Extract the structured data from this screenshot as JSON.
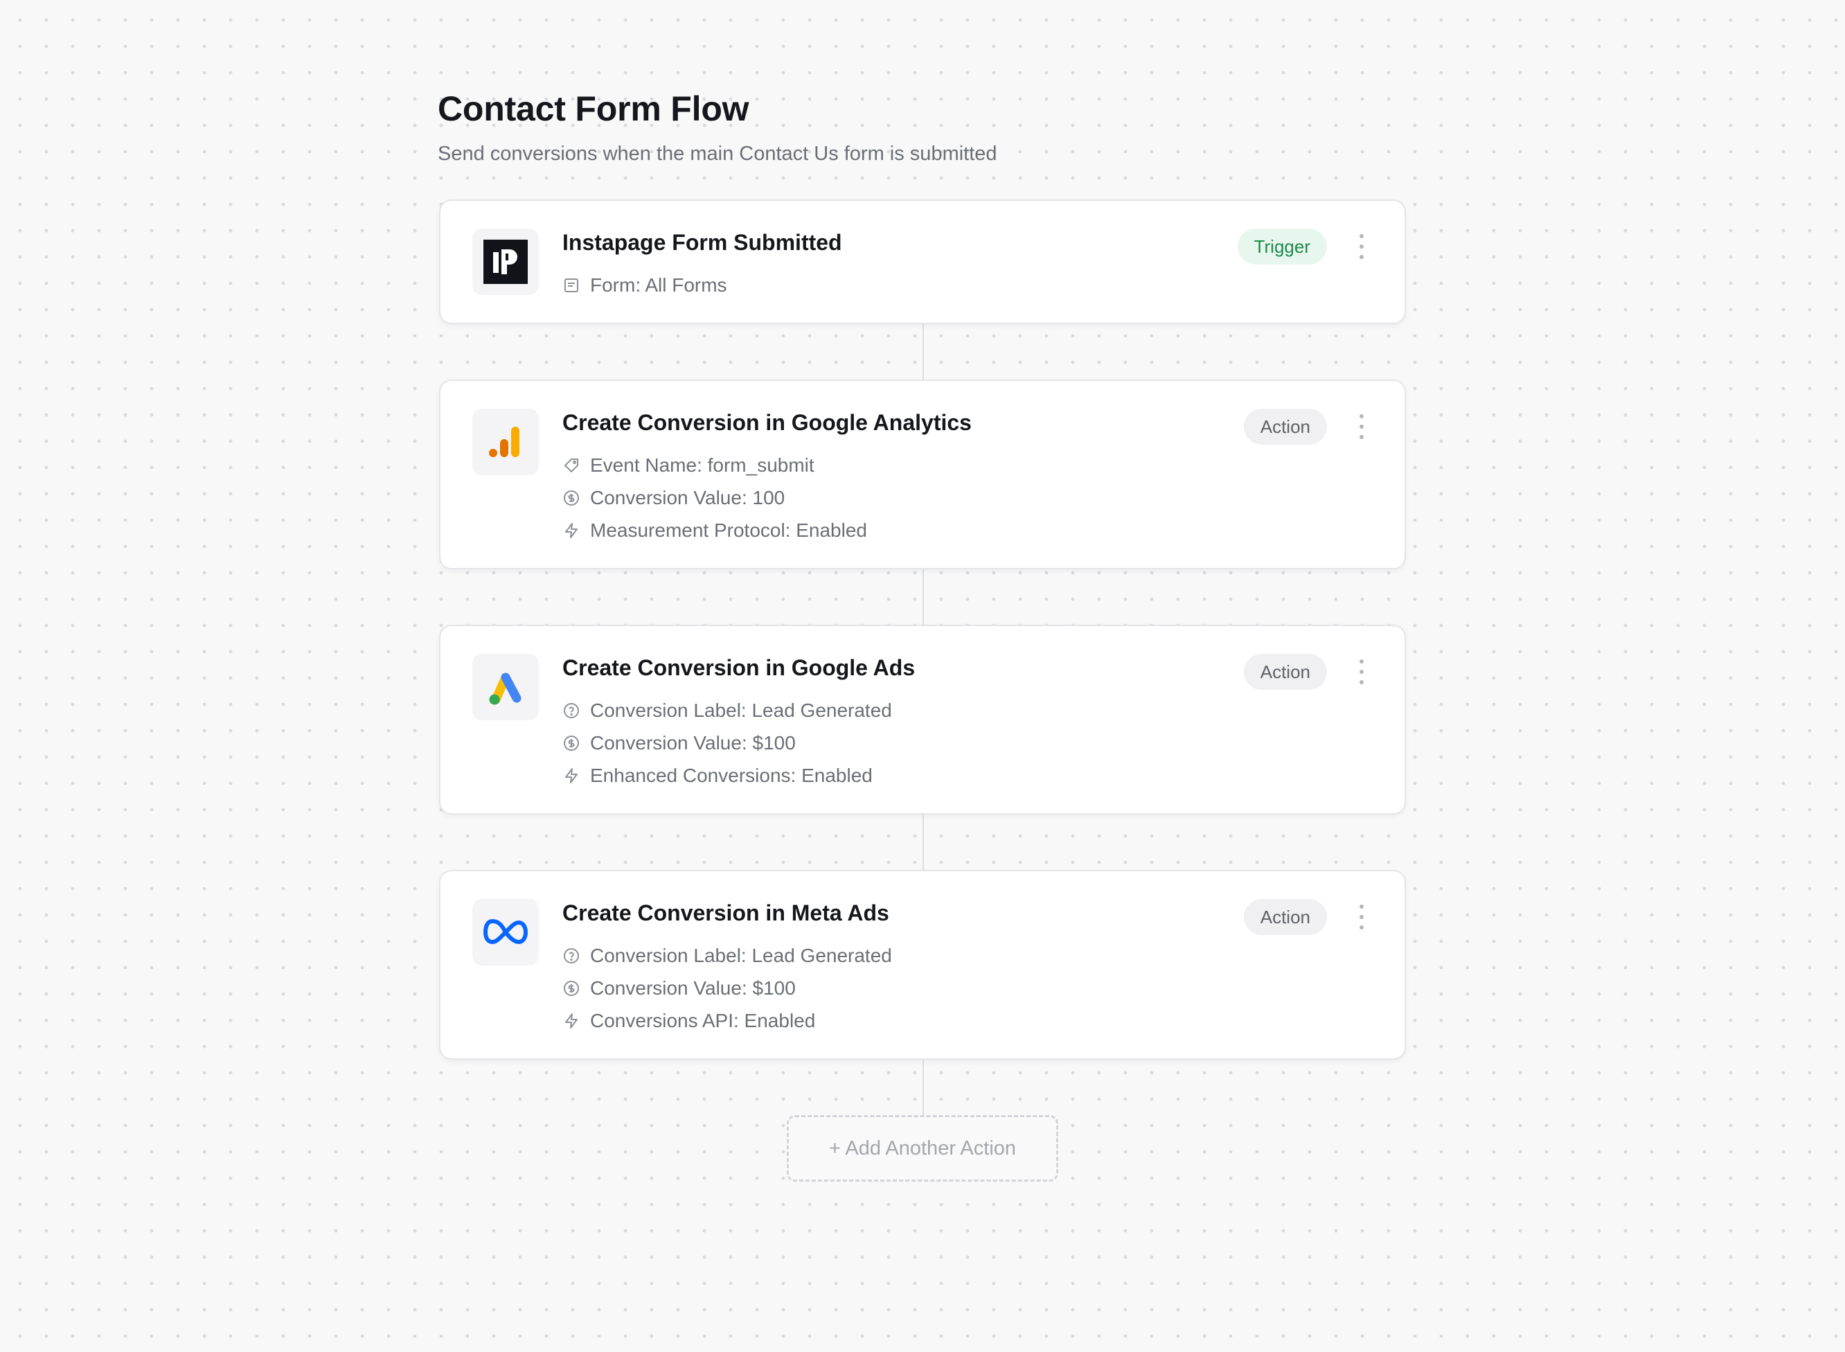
{
  "page": {
    "title": "Contact Form Flow",
    "subtitle": "Send conversions when the main Contact Us form is submitted"
  },
  "trigger": {
    "title": "Instapage Form Submitted",
    "badge": "Trigger",
    "logo": "instapage-logo",
    "details": [
      {
        "icon": "form-icon",
        "text": "Form: All Forms"
      }
    ]
  },
  "actions": [
    {
      "title": "Create Conversion in Google Analytics",
      "badge": "Action",
      "logo": "google-analytics-logo",
      "details": [
        {
          "icon": "tag-icon",
          "text": "Event Name: form_submit"
        },
        {
          "icon": "dollar-icon",
          "text": "Conversion Value: 100"
        },
        {
          "icon": "bolt-icon",
          "text": "Measurement Protocol: Enabled"
        }
      ]
    },
    {
      "title": "Create Conversion in Google Ads",
      "badge": "Action",
      "logo": "google-ads-logo",
      "details": [
        {
          "icon": "help-circle-icon",
          "text": "Conversion Label: Lead Generated"
        },
        {
          "icon": "dollar-icon",
          "text": "Conversion Value: $100"
        },
        {
          "icon": "bolt-icon",
          "text": "Enhanced Conversions: Enabled"
        }
      ]
    },
    {
      "title": "Create Conversion in Meta Ads",
      "badge": "Action",
      "logo": "meta-logo",
      "details": [
        {
          "icon": "help-circle-icon",
          "text": "Conversion Label: Lead Generated"
        },
        {
          "icon": "dollar-icon",
          "text": "Conversion Value: $100"
        },
        {
          "icon": "bolt-icon",
          "text": "Conversions API: Enabled"
        }
      ]
    }
  ],
  "add_action_label": "+ Add Another Action",
  "colors": {
    "trigger_badge_bg": "#e8f7ee",
    "trigger_badge_text": "#1d8a4a",
    "action_badge_bg": "#f0f0f2",
    "ga_orange": "#e37400",
    "ga_yellow": "#f9ab00",
    "ads_blue": "#4285f4",
    "ads_yellow": "#fbbc04",
    "ads_green": "#34a853",
    "meta_blue": "#0866ff"
  }
}
